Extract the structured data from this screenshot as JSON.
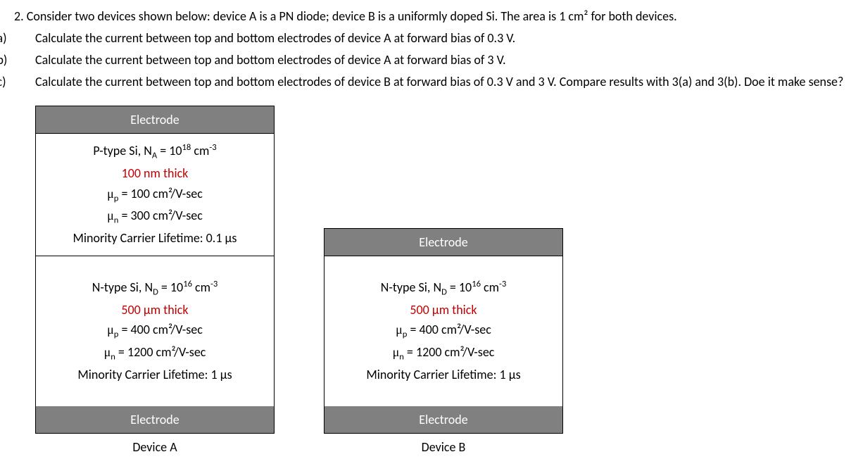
{
  "question": {
    "number": "2.",
    "mainText": "Consider two devices shown below: device A is a PN diode; device B is a uniformly doped Si. The area is 1 cm² for both devices.",
    "parts": [
      {
        "label": "(a)",
        "text": "Calculate the current between top and bottom electrodes of device A at forward bias of 0.3 V."
      },
      {
        "label": "(b)",
        "text": "Calculate the current between top and bottom electrodes of device A at forward bias of 3 V."
      },
      {
        "label": "(c)",
        "text": "Calculate the current between top and bottom electrodes of device B at forward bias of 0.3 V and 3 V. Compare results with 3(a) and 3(b). Doe it make sense?"
      }
    ]
  },
  "electrode_label": "Electrode",
  "deviceA": {
    "label": "Device A",
    "pLayer": {
      "doping": "P-type Si, N",
      "doping_sub": "A",
      "doping_val": " = 10",
      "doping_exp": "18",
      "doping_unit": " cm",
      "doping_unit_exp": "-3",
      "thickness": "100 nm thick",
      "mu_p": " = 100 cm²/V-sec",
      "mu_n": " = 300 cm²/V-sec",
      "lifetime": "Minority Carrier Lifetime: 0.1 μs"
    },
    "nLayer": {
      "doping": "N-type Si, N",
      "doping_sub": "D",
      "doping_val": " = 10",
      "doping_exp": "16",
      "doping_unit": " cm",
      "doping_unit_exp": "-3",
      "thickness": "500 μm thick",
      "mu_p": " = 400 cm²/V-sec",
      "mu_n": " = 1200 cm²/V-sec",
      "lifetime": "Minority Carrier Lifetime: 1 μs"
    }
  },
  "deviceB": {
    "label": "Device B",
    "nLayer": {
      "doping": "N-type Si, N",
      "doping_sub": "D",
      "doping_val": " = 10",
      "doping_exp": "16",
      "doping_unit": " cm",
      "doping_unit_exp": "-3",
      "thickness": "500 μm thick",
      "mu_p": " = 400 cm²/V-sec",
      "mu_n": " = 1200 cm²/V-sec",
      "lifetime": "Minority Carrier Lifetime: 1 μs"
    }
  },
  "mu_p_symbol": "μ",
  "mu_p_sub": "p",
  "mu_n_symbol": "μ",
  "mu_n_sub": "n"
}
